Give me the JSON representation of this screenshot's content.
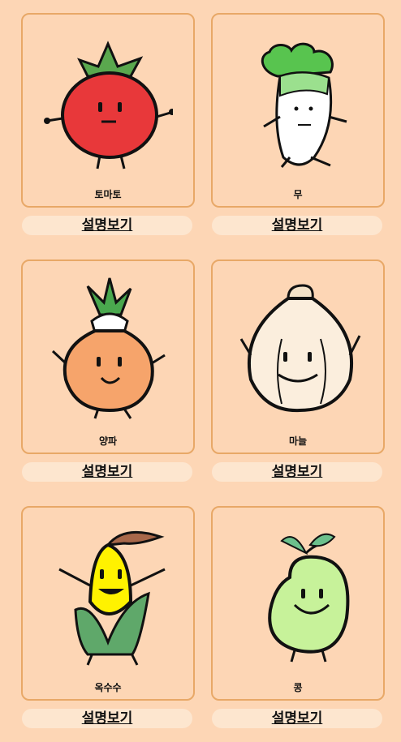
{
  "items": [
    {
      "name": "토마토",
      "button": "설명보기",
      "icon": "tomato-icon"
    },
    {
      "name": "무",
      "button": "설명보기",
      "icon": "radish-icon"
    },
    {
      "name": "양파",
      "button": "설명보기",
      "icon": "onion-icon"
    },
    {
      "name": "마늘",
      "button": "설명보기",
      "icon": "garlic-icon"
    },
    {
      "name": "옥수수",
      "button": "설명보기",
      "icon": "corn-icon"
    },
    {
      "name": "콩",
      "button": "설명보기",
      "icon": "bean-icon"
    }
  ],
  "colors": {
    "background": "#fdd6b5",
    "card_border": "#e8a867",
    "button_bg": "#fde6cf"
  }
}
